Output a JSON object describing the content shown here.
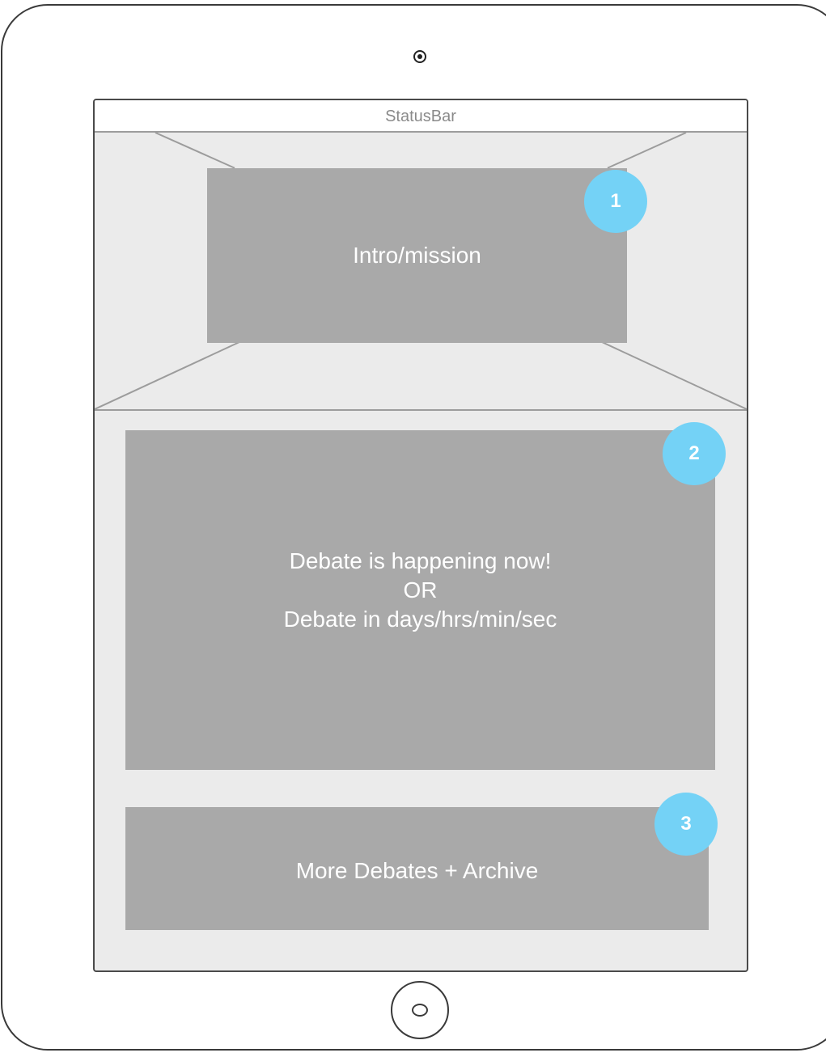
{
  "status_bar": {
    "label": "StatusBar"
  },
  "hero": {
    "label": "Intro/mission",
    "badge": "1"
  },
  "debate_panel": {
    "lines": [
      "Debate is happening now!",
      "OR",
      "Debate in days/hrs/min/sec"
    ],
    "badge": "2"
  },
  "more_panel": {
    "label": "More Debates + Archive",
    "badge": "3"
  },
  "colors": {
    "placeholder_fill": "#a9a9a9",
    "screen_background": "#ebebeb",
    "badge_fill": "#74d2f6",
    "device_outline": "#3a3a3a"
  },
  "icons": {
    "camera": "camera-icon",
    "home": "home-button-icon"
  }
}
